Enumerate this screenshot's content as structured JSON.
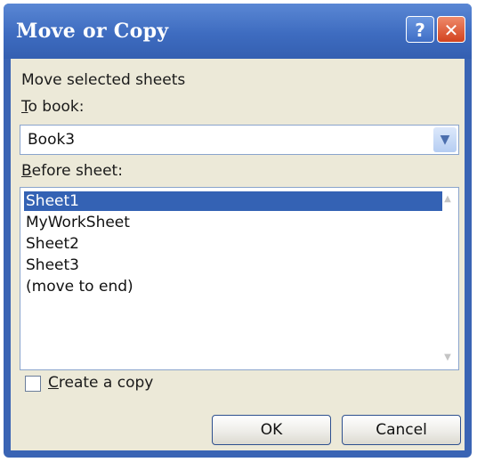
{
  "dialog": {
    "title": "Move or Copy",
    "help_label": "?",
    "close_label": "✕"
  },
  "labels": {
    "move_selected": "Move selected sheets",
    "to_book_prefix": "T",
    "to_book_rest": "o book:",
    "before_sheet_prefix": "B",
    "before_sheet_rest": "efore sheet:"
  },
  "to_book": {
    "value": "Book3",
    "arrow": "▼"
  },
  "sheets": [
    {
      "label": "Sheet1",
      "selected": true
    },
    {
      "label": "MyWorkSheet",
      "selected": false
    },
    {
      "label": "Sheet2",
      "selected": false
    },
    {
      "label": "Sheet3",
      "selected": false
    },
    {
      "label": "(move to end)",
      "selected": false
    }
  ],
  "scrollbar": {
    "up": "▲",
    "down": "▼"
  },
  "create_copy": {
    "prefix": "C",
    "rest": "reate a copy",
    "checked": false
  },
  "buttons": {
    "ok": "OK",
    "cancel": "Cancel"
  },
  "colors": {
    "titlebar": "#3e6cc0",
    "selection": "#3462b4",
    "client": "#ece9d8",
    "close": "#d2431f"
  }
}
